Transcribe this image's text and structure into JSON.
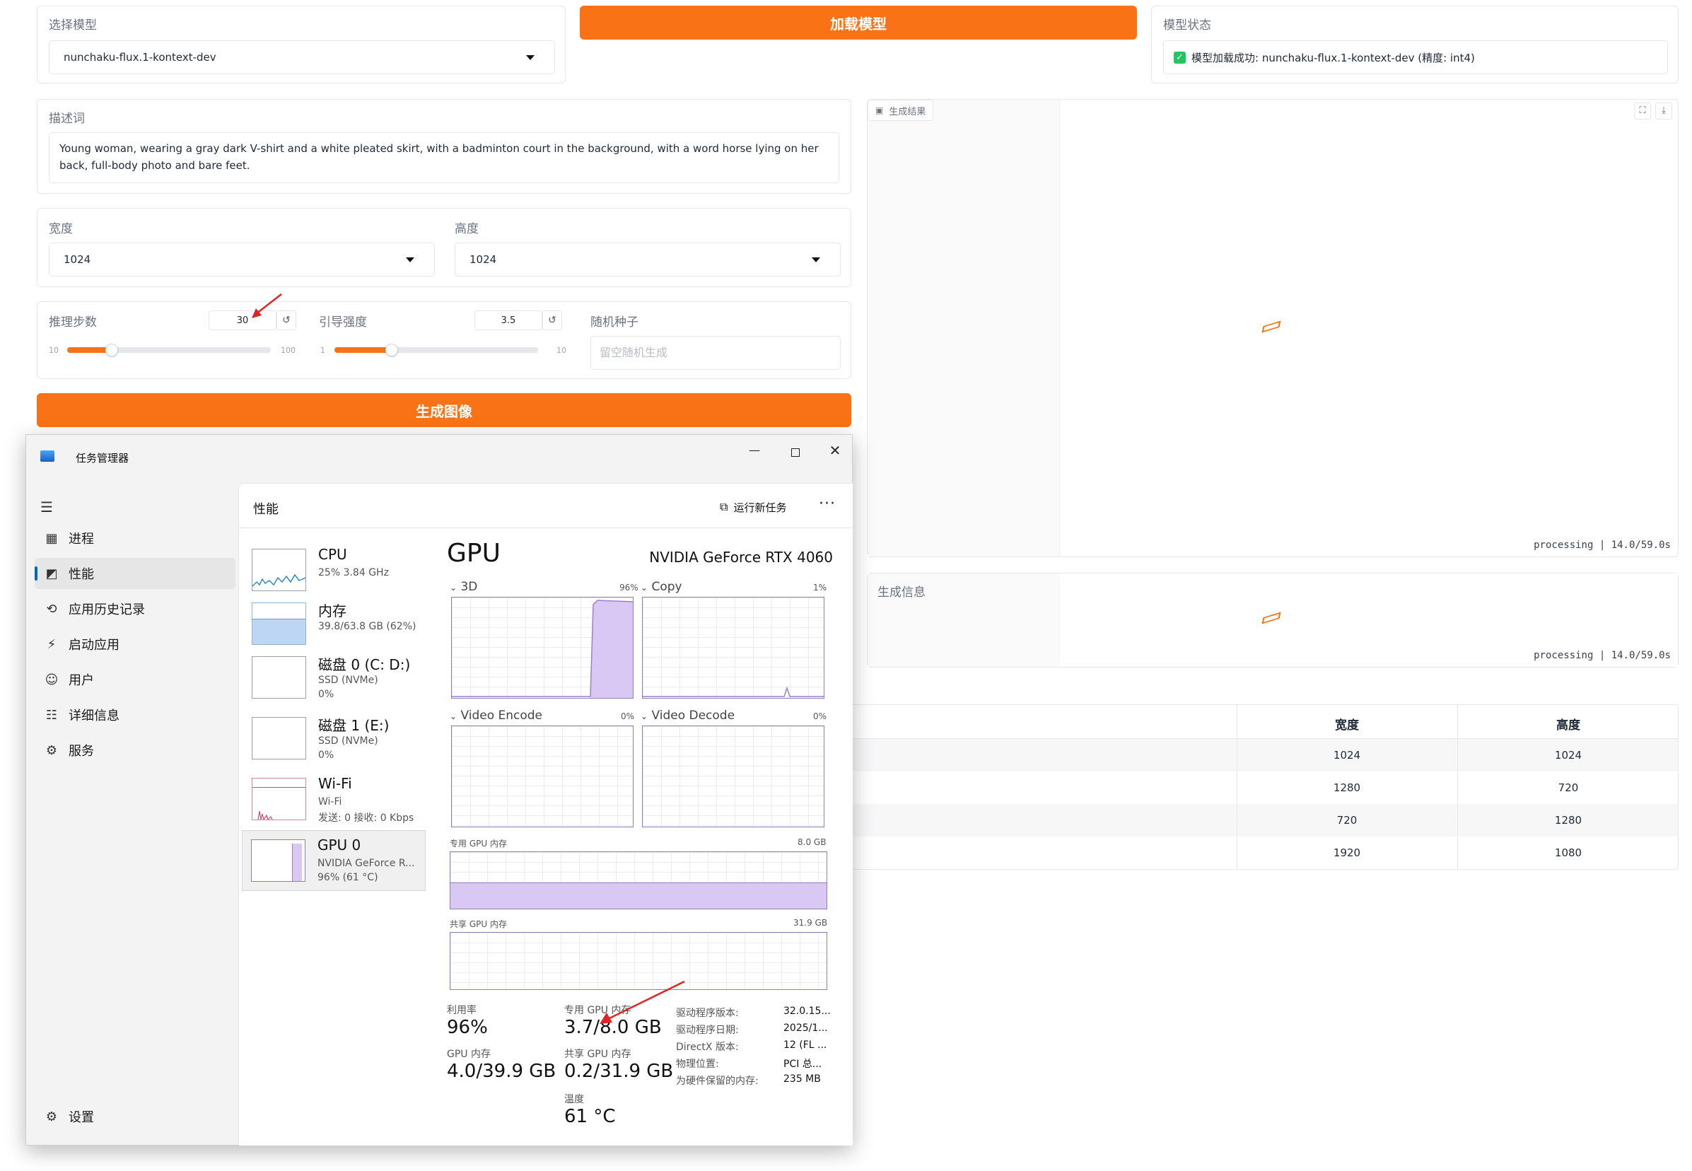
{
  "app": {
    "model_select": {
      "label": "选择模型",
      "value": "nunchaku-flux.1-kontext-dev"
    },
    "load_button": "加载模型",
    "model_status": {
      "label": "模型状态",
      "value": "模型加载成功: nunchaku-flux.1-kontext-dev (精度: int4)"
    },
    "prompt": {
      "label": "描述词",
      "value": "Young woman, wearing a gray dark V-shirt and a white pleated skirt, with a badminton court in the background, with a word horse lying on her back, full-body photo and bare feet."
    },
    "width": {
      "label": "宽度",
      "value": "1024"
    },
    "height": {
      "label": "高度",
      "value": "1024"
    },
    "steps": {
      "label": "推理步数",
      "value": "30",
      "min": "10",
      "max": "100",
      "fraction": 0.22
    },
    "guidance": {
      "label": "引导强度",
      "value": "3.5",
      "min": "1",
      "max": "10",
      "fraction": 0.28
    },
    "seed": {
      "label": "随机种子",
      "placeholder": "留空随机生成"
    },
    "generate_button": "生成图像",
    "result": {
      "label": "生成结果",
      "status": "processing | 14.0/59.0s"
    },
    "gen_info": {
      "label": "生成信息",
      "status": "processing | 14.0/59.0s"
    },
    "size_table": {
      "headers": [
        "宽度",
        "高度"
      ],
      "rows": [
        [
          "1024",
          "1024"
        ],
        [
          "1280",
          "720"
        ],
        [
          "720",
          "1280"
        ],
        [
          "1920",
          "1080"
        ]
      ]
    }
  },
  "task_manager": {
    "title": "任务管理器",
    "nav": [
      "进程",
      "性能",
      "应用历史记录",
      "启动应用",
      "用户",
      "详细信息",
      "服务"
    ],
    "settings": "设置",
    "section_title": "性能",
    "run_task": "运行新任务",
    "devices": [
      {
        "name": "CPU",
        "l1": "25% 3.84 GHz",
        "l2": ""
      },
      {
        "name": "内存",
        "l1": "39.8/63.8 GB (62%)",
        "l2": ""
      },
      {
        "name": "磁盘 0 (C: D:)",
        "l1": "SSD (NVMe)",
        "l2": "0%"
      },
      {
        "name": "磁盘 1 (E:)",
        "l1": "SSD (NVMe)",
        "l2": "0%"
      },
      {
        "name": "Wi-Fi",
        "l1": "Wi-Fi",
        "l2": "发送: 0 接收: 0 Kbps"
      },
      {
        "name": "GPU 0",
        "l1": "NVIDIA GeForce R...",
        "l2": "96% (61 °C)"
      }
    ],
    "gpu": {
      "heading": "GPU",
      "model": "NVIDIA GeForce RTX 4060",
      "g3d": {
        "label": "3D",
        "pct": "96%"
      },
      "gcopy": {
        "label": "Copy",
        "pct": "1%"
      },
      "genc": {
        "label": "Video Encode",
        "pct": "0%"
      },
      "gdec": {
        "label": "Video Decode",
        "pct": "0%"
      },
      "dedicated": {
        "label": "专用 GPU 内存",
        "max": "8.0 GB"
      },
      "shared": {
        "label": "共享 GPU 内存",
        "max": "31.9 GB"
      },
      "stats": {
        "util_label": "利用率",
        "util": "96%",
        "ded_label": "专用 GPU 内存",
        "ded": "3.7/8.0 GB",
        "gpumem_label": "GPU 内存",
        "gpumem": "4.0/39.9 GB",
        "shared_label": "共享 GPU 内存",
        "shared": "0.2/31.9 GB",
        "temp_label": "温度",
        "temp": "61 °C"
      },
      "info": [
        {
          "k": "驱动程序版本:",
          "v": "32.0.15..."
        },
        {
          "k": "驱动程序日期:",
          "v": "2025/1..."
        },
        {
          "k": "DirectX 版本:",
          "v": "12 (FL ..."
        },
        {
          "k": "物理位置:",
          "v": "PCI 总..."
        },
        {
          "k": "为硬件保留的内存:",
          "v": "235 MB"
        }
      ]
    }
  },
  "colors": {
    "accent": "#f97316",
    "gpu_purple": "#9b7fd6",
    "mem_blue": "#bcd6f4",
    "check_green": "#22c55e"
  }
}
